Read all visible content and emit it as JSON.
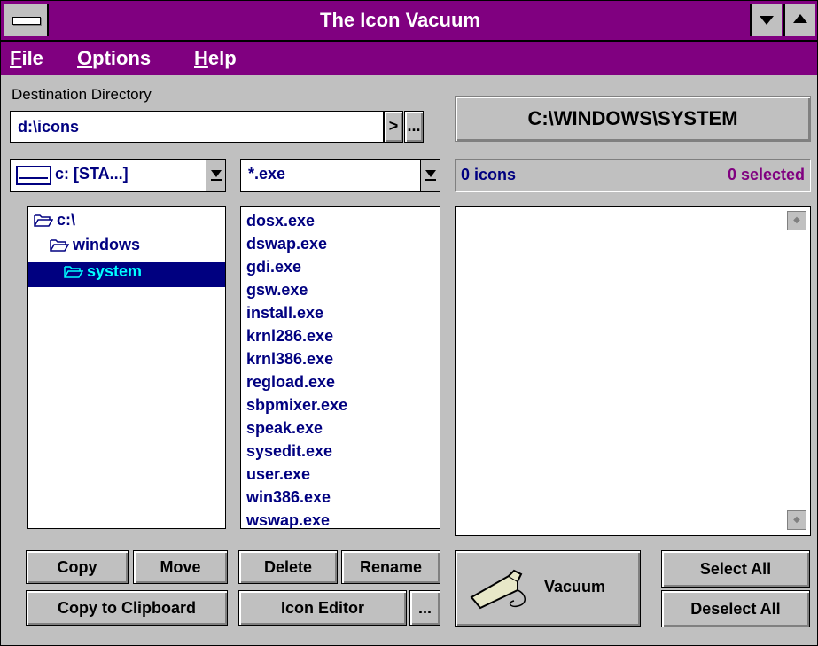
{
  "window": {
    "title": "The Icon Vacuum"
  },
  "menu": [
    {
      "first": "F",
      "rest": "ile"
    },
    {
      "first": "O",
      "rest": "ptions"
    },
    {
      "first": "H",
      "rest": "elp"
    }
  ],
  "destination": {
    "label": "Destination Directory",
    "value": "d:\\icons",
    "go_label": ">",
    "browse_label": "..."
  },
  "current_path": "C:\\WINDOWS\\SYSTEM",
  "drive_select": {
    "value": "c: [STA...]"
  },
  "filter_select": {
    "value": "*.exe"
  },
  "status": {
    "icons": "0 icons",
    "selected": "0 selected",
    "selected_color": "#800080"
  },
  "tree": [
    {
      "label": "c:\\"
    },
    {
      "label": "windows"
    },
    {
      "label": "system"
    }
  ],
  "files": [
    "dosx.exe",
    "dswap.exe",
    "gdi.exe",
    "gsw.exe",
    "install.exe",
    "krnl286.exe",
    "krnl386.exe",
    "regload.exe",
    "sbpmixer.exe",
    "speak.exe",
    "sysedit.exe",
    "user.exe",
    "win386.exe",
    "wswap.exe"
  ],
  "buttons": {
    "copy": "Copy",
    "move": "Move",
    "delete": "Delete",
    "rename": "Rename",
    "copy_clipboard": "Copy to Clipboard",
    "icon_editor": "Icon Editor",
    "icon_editor_more": "...",
    "vacuum": "Vacuum",
    "select_all": "Select All",
    "deselect_all": "Deselect All"
  },
  "colors": {
    "title_bar": "#800080",
    "text_blue": "#000080",
    "selection": "#000080",
    "selection_text": "#00ffff"
  }
}
